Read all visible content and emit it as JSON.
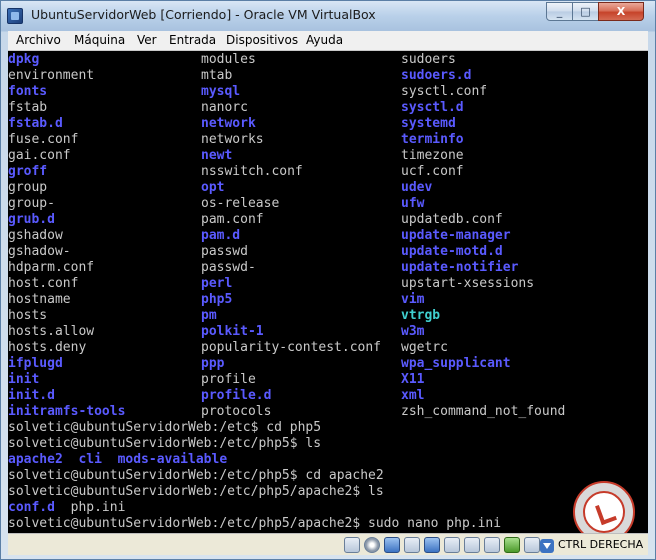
{
  "window": {
    "title": "UbuntuServidorWeb [Corriendo] - Oracle VM VirtualBox",
    "minimize_label": "_",
    "maximize_label": "□",
    "close_label": "X"
  },
  "menu": [
    "Archivo",
    "Máquina",
    "Ver",
    "Entrada",
    "Dispositivos",
    "Ayuda"
  ],
  "listing": [
    [
      {
        "t": "dpkg",
        "c": "blue"
      },
      {
        "t": "modules",
        "c": "white"
      },
      {
        "t": "sudoers",
        "c": "white"
      }
    ],
    [
      {
        "t": "environment",
        "c": "white"
      },
      {
        "t": "mtab",
        "c": "white"
      },
      {
        "t": "sudoers.d",
        "c": "blue"
      }
    ],
    [
      {
        "t": "fonts",
        "c": "blue"
      },
      {
        "t": "mysql",
        "c": "blue"
      },
      {
        "t": "sysctl.conf",
        "c": "white"
      }
    ],
    [
      {
        "t": "fstab",
        "c": "white"
      },
      {
        "t": "nanorc",
        "c": "white"
      },
      {
        "t": "sysctl.d",
        "c": "blue"
      }
    ],
    [
      {
        "t": "fstab.d",
        "c": "blue"
      },
      {
        "t": "network",
        "c": "blue"
      },
      {
        "t": "systemd",
        "c": "blue"
      }
    ],
    [
      {
        "t": "fuse.conf",
        "c": "white"
      },
      {
        "t": "networks",
        "c": "white"
      },
      {
        "t": "terminfo",
        "c": "blue"
      }
    ],
    [
      {
        "t": "gai.conf",
        "c": "white"
      },
      {
        "t": "newt",
        "c": "blue"
      },
      {
        "t": "timezone",
        "c": "white"
      }
    ],
    [
      {
        "t": "groff",
        "c": "blue"
      },
      {
        "t": "nsswitch.conf",
        "c": "white"
      },
      {
        "t": "ucf.conf",
        "c": "white"
      }
    ],
    [
      {
        "t": "group",
        "c": "white"
      },
      {
        "t": "opt",
        "c": "blue"
      },
      {
        "t": "udev",
        "c": "blue"
      }
    ],
    [
      {
        "t": "group-",
        "c": "white"
      },
      {
        "t": "os-release",
        "c": "white"
      },
      {
        "t": "ufw",
        "c": "blue"
      }
    ],
    [
      {
        "t": "grub.d",
        "c": "blue"
      },
      {
        "t": "pam.conf",
        "c": "white"
      },
      {
        "t": "updatedb.conf",
        "c": "white"
      }
    ],
    [
      {
        "t": "gshadow",
        "c": "white"
      },
      {
        "t": "pam.d",
        "c": "blue"
      },
      {
        "t": "update-manager",
        "c": "blue"
      }
    ],
    [
      {
        "t": "gshadow-",
        "c": "white"
      },
      {
        "t": "passwd",
        "c": "white"
      },
      {
        "t": "update-motd.d",
        "c": "blue"
      }
    ],
    [
      {
        "t": "hdparm.conf",
        "c": "white"
      },
      {
        "t": "passwd-",
        "c": "white"
      },
      {
        "t": "update-notifier",
        "c": "blue"
      }
    ],
    [
      {
        "t": "host.conf",
        "c": "white"
      },
      {
        "t": "perl",
        "c": "blue"
      },
      {
        "t": "upstart-xsessions",
        "c": "white"
      }
    ],
    [
      {
        "t": "hostname",
        "c": "white"
      },
      {
        "t": "php5",
        "c": "blue"
      },
      {
        "t": "vim",
        "c": "blue"
      }
    ],
    [
      {
        "t": "hosts",
        "c": "white"
      },
      {
        "t": "pm",
        "c": "blue"
      },
      {
        "t": "vtrgb",
        "c": "cyan"
      }
    ],
    [
      {
        "t": "hosts.allow",
        "c": "white"
      },
      {
        "t": "polkit-1",
        "c": "blue"
      },
      {
        "t": "w3m",
        "c": "blue"
      }
    ],
    [
      {
        "t": "hosts.deny",
        "c": "white"
      },
      {
        "t": "popularity-contest.conf",
        "c": "white"
      },
      {
        "t": "wgetrc",
        "c": "white"
      }
    ],
    [
      {
        "t": "ifplugd",
        "c": "blue"
      },
      {
        "t": "ppp",
        "c": "blue"
      },
      {
        "t": "wpa_supplicant",
        "c": "blue"
      }
    ],
    [
      {
        "t": "init",
        "c": "blue"
      },
      {
        "t": "profile",
        "c": "white"
      },
      {
        "t": "X11",
        "c": "blue"
      }
    ],
    [
      {
        "t": "init.d",
        "c": "blue"
      },
      {
        "t": "profile.d",
        "c": "blue"
      },
      {
        "t": "xml",
        "c": "blue"
      }
    ],
    [
      {
        "t": "initramfs-tools",
        "c": "blue"
      },
      {
        "t": "protocols",
        "c": "white"
      },
      {
        "t": "zsh_command_not_found",
        "c": "white"
      }
    ]
  ],
  "commands": [
    {
      "text": "solvetic@ubuntuServidorWeb:/etc$ cd php5",
      "kind": "prompt"
    },
    {
      "text": "solvetic@ubuntuServidorWeb:/etc/php5$ ls",
      "kind": "prompt"
    },
    {
      "text": "apache2  cli  mods-available",
      "kind": "blue"
    },
    {
      "text": "solvetic@ubuntuServidorWeb:/etc/php5$ cd apache2",
      "kind": "prompt"
    },
    {
      "text": "solvetic@ubuntuServidorWeb:/etc/php5/apache2$ ls",
      "kind": "prompt"
    },
    {
      "text": "conf.d",
      "kind": "mixed",
      "rest": "  php.ini"
    },
    {
      "text": "solvetic@ubuntuServidorWeb:/etc/php5/apache2$ sudo nano php.ini",
      "kind": "prompt"
    }
  ],
  "status": {
    "host_key": "CTRL DERECHA"
  }
}
